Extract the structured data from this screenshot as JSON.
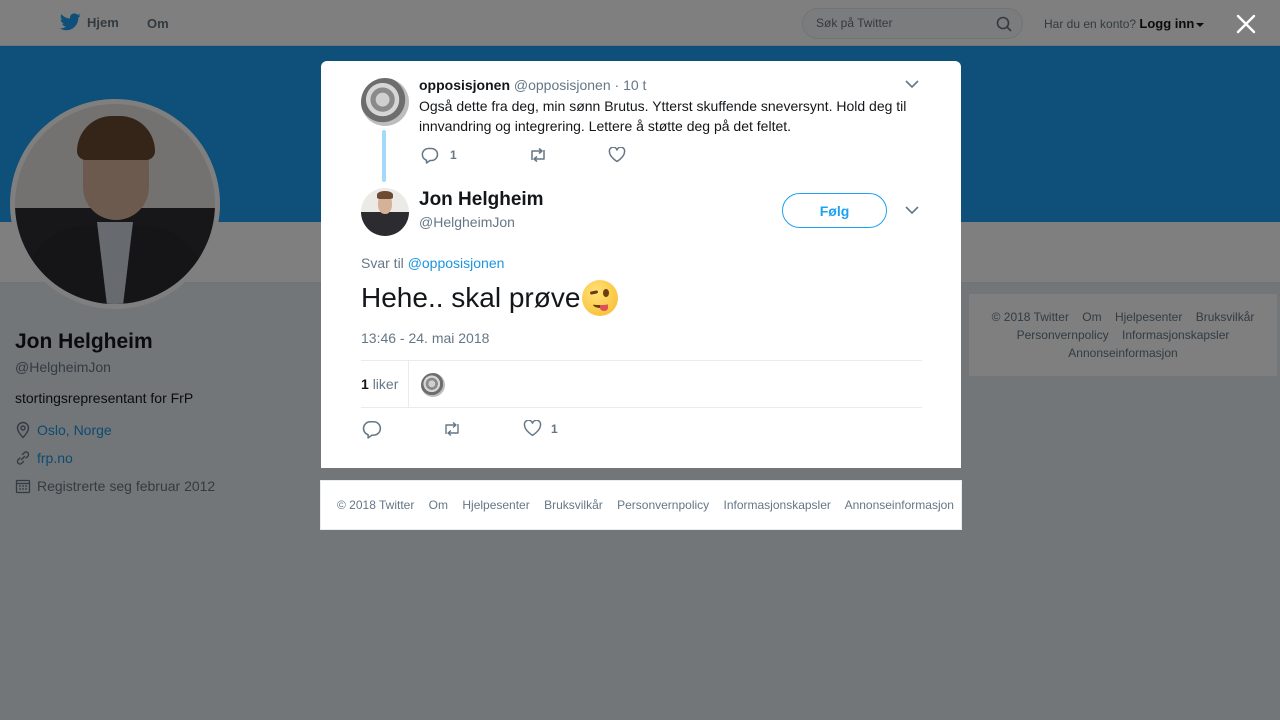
{
  "nav": {
    "home_label": "Hjem",
    "about_label": "Om",
    "search_placeholder": "Søk på Twitter",
    "login_prompt": "Har du en konto?",
    "login_label": "Logg inn"
  },
  "profile": {
    "name": "Jon Helgheim",
    "handle": "@HelgheimJon",
    "bio": "stortingsrepresentant for FrP",
    "location": "Oslo, Norge",
    "website": "frp.no",
    "joined": "Registrerte seg februar 2012"
  },
  "sidebar_footer": {
    "items": [
      "© 2018 Twitter",
      "Om",
      "Hjelpesenter",
      "Bruksvilkår",
      "Personvernpolicy",
      "Informasjonskapsler",
      "Annonseinformasjon"
    ]
  },
  "parent_tweet": {
    "author_name": "opposisjonen",
    "author_handle": "@opposisjonen",
    "time": "· 10 t",
    "text": "Også dette fra deg, min sønn Brutus. Ytterst skuffende sneversynt. Hold deg til innvandring og integrering. Lettere å støtte deg på det feltet.",
    "reply_count": "1"
  },
  "main_tweet": {
    "author_name": "Jon Helgheim",
    "author_handle": "@HelgheimJon",
    "follow_label": "Følg",
    "reply_prefix": "Svar til",
    "reply_to": "@opposisjonen",
    "text": "Hehe.. skal prøve",
    "emoji": "winking-face",
    "timestamp": "13:46 - 24. mai 2018",
    "likes_count": "1",
    "likes_label": "liker",
    "like_action_count": "1"
  },
  "modal_footer": {
    "items": [
      "© 2018 Twitter",
      "Om",
      "Hjelpesenter",
      "Bruksvilkår",
      "Personvernpolicy",
      "Informasjonskapsler",
      "Annonseinformasjon"
    ]
  },
  "colors": {
    "twitter_blue": "#1da1f2",
    "link_blue": "#1b95e0",
    "thread_line": "#a4d9f9",
    "muted_text": "#657786"
  }
}
